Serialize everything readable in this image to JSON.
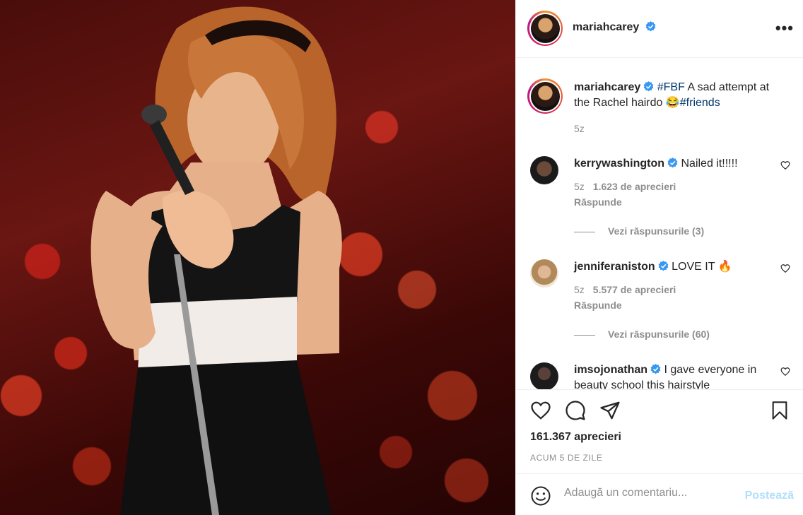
{
  "post": {
    "author": "mariahcarey",
    "more_icon": "•••"
  },
  "caption": {
    "author": "mariahcarey",
    "hashtag1": "#FBF",
    "text": " A sad attempt at the Rachel hairdo 😂",
    "hashtag2": "#friends",
    "age": "5z"
  },
  "comments": [
    {
      "author": "kerrywashington",
      "text": "Nailed it!!!!!",
      "age": "5z",
      "likes": "1.623 de aprecieri",
      "reply": "Răspunde",
      "view_replies": "Vezi răspunsurile (3)"
    },
    {
      "author": "jenniferaniston",
      "text": "LOVE IT 🔥",
      "age": "5z",
      "likes": "5.577 de aprecieri",
      "reply": "Răspunde",
      "view_replies": "Vezi răspunsurile (60)"
    },
    {
      "author": "imsojonathan",
      "text": "I gave everyone in beauty school this hairstyle"
    }
  ],
  "actions": {
    "likes_count": "161.367 aprecieri",
    "time": "ACUM 5 DE ZILE"
  },
  "composer": {
    "placeholder": "Adaugă un comentariu...",
    "post_label": "Postează"
  },
  "colors": {
    "link": "#00376b",
    "verified": "#3897f0",
    "post_disabled": "#b2dffc"
  }
}
